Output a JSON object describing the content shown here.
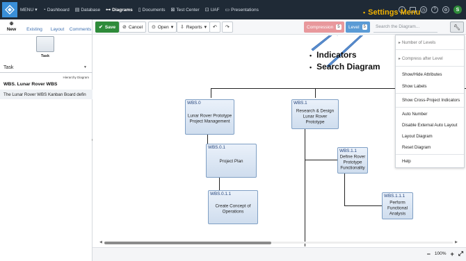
{
  "nav": {
    "menu_label": "MENU",
    "items": [
      {
        "icon": "dashboard-icon",
        "glyph": "◔",
        "label": "Dashboard"
      },
      {
        "icon": "database-icon",
        "glyph": "▤",
        "label": "Database"
      },
      {
        "icon": "diagrams-icon",
        "glyph": "⊶",
        "label": "Diagrams",
        "active": true
      },
      {
        "icon": "documents-icon",
        "glyph": "▯",
        "label": "Documents"
      },
      {
        "icon": "test-center-icon",
        "glyph": "⊠",
        "label": "Test Center"
      },
      {
        "icon": "uaf-icon",
        "glyph": "⊡",
        "label": "UAF"
      },
      {
        "icon": "presentations-icon",
        "glyph": "▭",
        "label": "Presentations"
      }
    ],
    "avatar_initial": "S"
  },
  "annotations": {
    "settings_menu": "Settings Menu",
    "indicators": "Indicators",
    "search_diagram": "Search Diagram",
    "accent_color": "#f2b200"
  },
  "leftpanel": {
    "tabs": [
      {
        "icon": "new-icon",
        "glyph": "⊕",
        "label": "New",
        "active": true
      },
      {
        "icon": "existing-icon",
        "glyph": "",
        "label": "Existing"
      },
      {
        "icon": "layout-icon",
        "glyph": "",
        "label": "Layout"
      },
      {
        "icon": "comments-icon",
        "glyph": "",
        "label": "Comments"
      }
    ],
    "tile_label": "Task",
    "select_value": "Task",
    "subtitle": "Hierarchy Diagram",
    "items": [
      {
        "label": "WBS. Lunar Rover WBS"
      },
      {
        "label": "The Lunar Rover WBS Kanban Board defin"
      }
    ]
  },
  "toolbar": {
    "save_label": "Save",
    "cancel_label": "Cancel",
    "open_label": "Open",
    "reports_label": "Reports",
    "compression_label": "Compression",
    "compression_value": "5",
    "level_label": "Level",
    "level_value": "5",
    "search_placeholder": "Search the Diagram...",
    "colors": {
      "save": "#2e8b3a",
      "compression": "#e8989c",
      "level": "#5b9bd5"
    }
  },
  "diagram": {
    "nodes": [
      {
        "id": "WBS.0",
        "title": "Lunar Rover Prototype Project Management"
      },
      {
        "id": "WBS.0.1",
        "title": "Project Plan"
      },
      {
        "id": "WBS.0.1.1",
        "title": "Create Concept of Operations"
      },
      {
        "id": "WBS.1",
        "title": "Research & Design Lunar Rover Prototype"
      },
      {
        "id": "WBS.1.1",
        "title": "Define Rover Prototype Functionality"
      },
      {
        "id": "WBS.1.1.1",
        "title": "Perform Functional Analysis"
      }
    ]
  },
  "settings_menu": {
    "items": [
      {
        "label": "Number of Levels",
        "submenu": true
      },
      {
        "label": "Compress after Level",
        "submenu": true
      },
      {
        "label": "Show/Hide Attributes"
      },
      {
        "label": "Show Labels"
      },
      {
        "label": "Show Cross-Project Indicators"
      },
      {
        "label": "Auto Number"
      },
      {
        "label": "Disable External Auto Layout"
      },
      {
        "label": "Layout Diagram"
      },
      {
        "label": "Reset Diagram"
      },
      {
        "label": "Help"
      }
    ]
  },
  "zoom": {
    "value": "100%"
  }
}
